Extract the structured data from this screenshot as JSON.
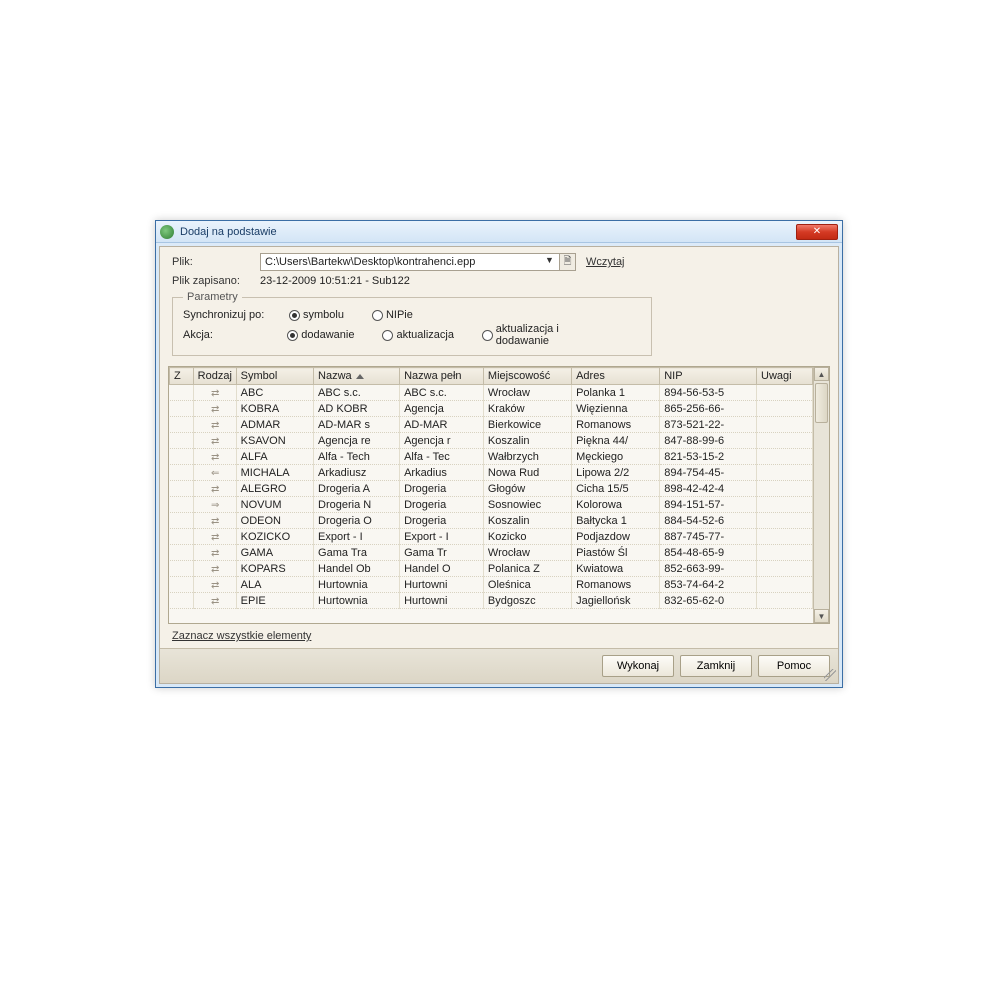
{
  "window": {
    "title": "Dodaj na podstawie",
    "close_symbol": "✕"
  },
  "file": {
    "label": "Plik:",
    "path": "C:\\Users\\Bartekw\\Desktop\\kontrahenci.epp",
    "load_link": "Wczytaj",
    "saved_label": "Plik zapisano:",
    "saved_value": "23-12-2009 10:51:21 - Sub122"
  },
  "params": {
    "legend": "Parametry",
    "sync_label": "Synchronizuj po:",
    "sync_options": {
      "symbolu": "symbolu",
      "nipie": "NIPie"
    },
    "sync_selected": "symbolu",
    "action_label": "Akcja:",
    "action_options": {
      "dodawanie": "dodawanie",
      "aktualizacja": "aktualizacja",
      "aktualizacja_i_dodawanie": "aktualizacja i dodawanie"
    },
    "action_selected": "dodawanie"
  },
  "columns": {
    "z": "Z",
    "rodzaj": "Rodzaj",
    "symbol": "Symbol",
    "nazwa": "Nazwa",
    "nazwa_pelna": "Nazwa pełn",
    "miejscowosc": "Miejscowość",
    "adres": "Adres",
    "nip": "NIP",
    "uwagi": "Uwagi"
  },
  "rows": [
    {
      "rodzaj": "bi",
      "symbol": "ABC",
      "nazwa": "ABC s.c.",
      "nazwa_p": "ABC s.c.",
      "miejsc": "Wrocław",
      "adres": "Polanka  1",
      "nip": "894-56-53-5"
    },
    {
      "rodzaj": "bi",
      "symbol": "KOBRA",
      "nazwa": "AD KOBR",
      "nazwa_p": "Agencja",
      "miejsc": "Kraków",
      "adres": "Więzienna",
      "nip": "865-256-66-"
    },
    {
      "rodzaj": "bi",
      "symbol": "ADMAR",
      "nazwa": "AD-MAR s",
      "nazwa_p": "AD-MAR",
      "miejsc": "Bierkowice",
      "adres": "Romanows",
      "nip": "873-521-22-"
    },
    {
      "rodzaj": "bi",
      "symbol": "KSAVON",
      "nazwa": "Agencja re",
      "nazwa_p": "Agencja r",
      "miejsc": "Koszalin",
      "adres": "Piękna  44/",
      "nip": "847-88-99-6"
    },
    {
      "rodzaj": "bi",
      "symbol": "ALFA",
      "nazwa": "Alfa - Tech",
      "nazwa_p": "Alfa - Tec",
      "miejsc": "Wałbrzych",
      "adres": "Męckiego",
      "nip": "821-53-15-2"
    },
    {
      "rodzaj": "left",
      "symbol": "MICHALA",
      "nazwa": "Arkadiusz",
      "nazwa_p": "Arkadius",
      "miejsc": "Nowa Rud",
      "adres": "Lipowa  2/2",
      "nip": "894-754-45-"
    },
    {
      "rodzaj": "bi",
      "symbol": "ALEGRO",
      "nazwa": "Drogeria A",
      "nazwa_p": "Drogeria",
      "miejsc": "Głogów",
      "adres": "Cicha  15/5",
      "nip": "898-42-42-4"
    },
    {
      "rodzaj": "right",
      "symbol": "NOVUM",
      "nazwa": "Drogeria N",
      "nazwa_p": "Drogeria",
      "miejsc": "Sosnowiec",
      "adres": "Kolorowa",
      "nip": "894-151-57-"
    },
    {
      "rodzaj": "bi",
      "symbol": "ODEON",
      "nazwa": "Drogeria O",
      "nazwa_p": "Drogeria",
      "miejsc": "Koszalin",
      "adres": "Bałtycka  1",
      "nip": "884-54-52-6"
    },
    {
      "rodzaj": "bi",
      "symbol": "KOZICKO",
      "nazwa": "Export - I",
      "nazwa_p": "Export - I",
      "miejsc": "Kozicko",
      "adres": "Podjazdow",
      "nip": "887-745-77-"
    },
    {
      "rodzaj": "bi",
      "symbol": "GAMA",
      "nazwa": "Gama Tra",
      "nazwa_p": "Gama Tr",
      "miejsc": "Wrocław",
      "adres": "Piastów Śl",
      "nip": "854-48-65-9"
    },
    {
      "rodzaj": "bi",
      "symbol": "KOPARS",
      "nazwa": "Handel Ob",
      "nazwa_p": "Handel O",
      "miejsc": "Polanica Z",
      "adres": "Kwiatowa",
      "nip": "852-663-99-"
    },
    {
      "rodzaj": "bi",
      "symbol": "ALA",
      "nazwa": "Hurtownia",
      "nazwa_p": "Hurtowni",
      "miejsc": "Oleśnica",
      "adres": "Romanows",
      "nip": "853-74-64-2"
    },
    {
      "rodzaj": "bi",
      "symbol": "EPIE",
      "nazwa": "Hurtownia",
      "nazwa_p": "Hurtowni",
      "miejsc": "Bydgoszc",
      "adres": "Jagiellońsk",
      "nip": "832-65-62-0"
    }
  ],
  "select_all": "Zaznacz wszystkie elementy",
  "buttons": {
    "execute": "Wykonaj",
    "close": "Zamknij",
    "help": "Pomoc"
  },
  "icons": {
    "bi": "⇄",
    "left": "⇐",
    "right": "⇒",
    "dropdown": "▼",
    "file": "🗎",
    "up": "▲",
    "down": "▼"
  }
}
